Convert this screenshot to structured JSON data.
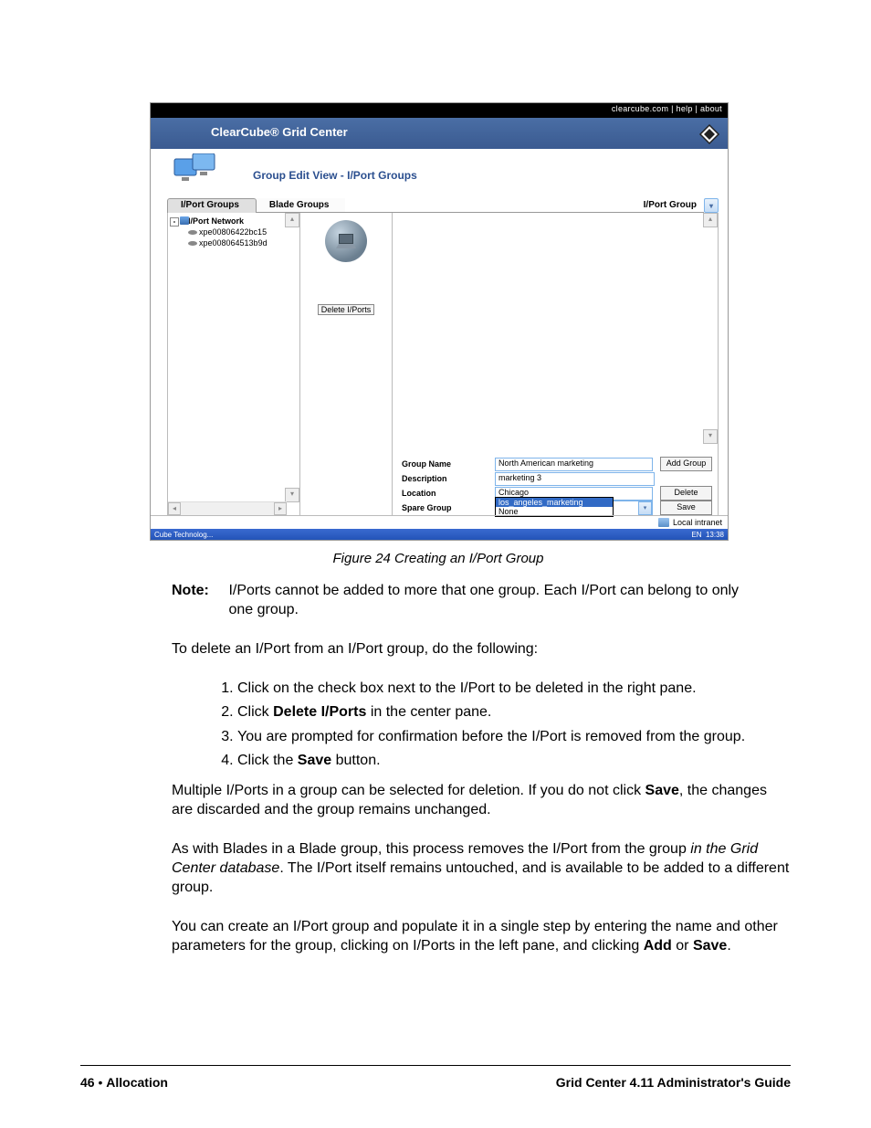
{
  "topLinks": "clearcube.com  |  help  |  about",
  "headerTitle": "ClearCube® Grid Center",
  "sectionTitle": "Group Edit View - I/Port Groups",
  "tabs": {
    "left": "I/Port Groups",
    "left2": "Blade Groups",
    "right": "I/Port Group"
  },
  "tree": {
    "root": "I/Port Network",
    "children": [
      "xpe00806422bc15",
      "xpe008064513b9d"
    ]
  },
  "centerButton": "Delete I/Ports",
  "form": {
    "rows": [
      {
        "label": "Group Name",
        "value": "North American marketing",
        "button": "Add Group"
      },
      {
        "label": "Description",
        "value": "marketing 3",
        "button": ""
      },
      {
        "label": "Location",
        "value": "Chicago",
        "button": "Delete"
      },
      {
        "label": "Spare Group",
        "value": "los_angeles_marketing",
        "button": "Save",
        "type": "select"
      }
    ],
    "ddOptions": [
      "los_angeles_marketing",
      "None"
    ]
  },
  "statusText": "Local intranet",
  "taskbar": {
    "left": "Cube Technolog...",
    "lang": "EN",
    "time": "13:38"
  },
  "caption": "Figure 24  Creating an I/Port Group",
  "note": {
    "label": "Note:",
    "body": "I/Ports cannot be added to more that one group. Each I/Port can belong to only one group."
  },
  "para1": "To delete an I/Port from an I/Port group, do the following:",
  "steps": [
    "Click on the check box next to the I/Port to be deleted in the right pane.",
    {
      "pre": "Click ",
      "b": "Delete I/Ports",
      "post": " in the center pane."
    },
    "You are prompted for confirmation before the I/Port is removed from the group.",
    {
      "pre": "Click the ",
      "b": "Save",
      "post": " button."
    }
  ],
  "para2": {
    "pre": "Multiple I/Ports in a group can be selected for deletion. If you do not click ",
    "b": "Save",
    "post": ", the changes are discarded and the group remains unchanged."
  },
  "para3": {
    "pre": "As with Blades in a Blade group, this process removes the I/Port from the group ",
    "i": "in the Grid Center database",
    "post": ". The I/Port itself remains untouched, and is available to be added to a different group."
  },
  "para4": {
    "pre": "You can create an I/Port group and populate it in a single step by entering the name and other parameters for the group, clicking on I/Ports in the left pane, and clicking ",
    "b1": "Add",
    "mid": " or ",
    "b2": "Save",
    "post": "."
  },
  "footer": {
    "leftNum": "46 ",
    "leftBullet": "• ",
    "leftText": "Allocation",
    "right": "Grid Center 4.11 Administrator's Guide"
  }
}
